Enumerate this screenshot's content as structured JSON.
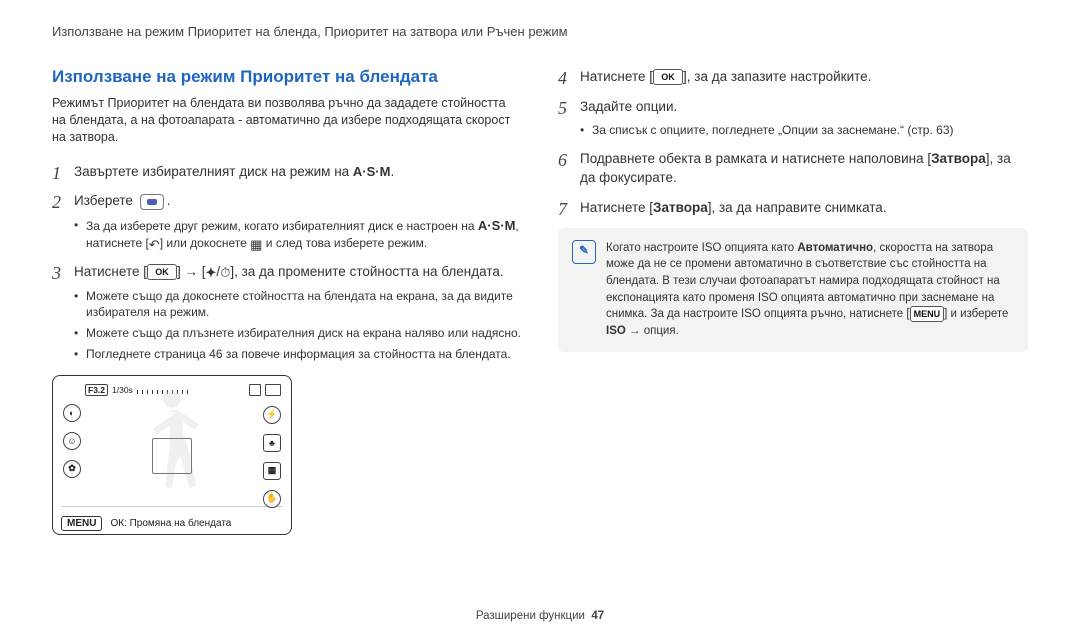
{
  "header": {
    "breadcrumb": "Използване на режим Приоритет на бленда, Приоритет на затвора или Ръчен режим"
  },
  "title": "Използване на режим Приоритет на блендата",
  "intro": "Режимът Приоритет на блендата ви позволява ръчно да зададете стойността на блендата, а на фотоапарата ‑ автоматично да избере подходящата скорост на затвора.",
  "icons": {
    "dial_mode": "A·S·M",
    "ok": "OK",
    "flash": "✦",
    "timer": "⏱",
    "return": "↶",
    "menu": "MENU",
    "arrow": "→"
  },
  "steps_left": {
    "s1": {
      "text_a": "Завъртете избирателният диск на режим на ",
      "text_b": "."
    },
    "s2": {
      "text_a": "Изберете ",
      "sub1_a": "За да изберете друг режим, когато избирателният диск е настроен на ",
      "sub1_b": ", натиснете [",
      "sub1_c": "] или докоснете ",
      "sub1_d": " и след това изберете режим."
    },
    "s3": {
      "text_a": "Натиснете [",
      "text_b": "] → [",
      "text_c": "/",
      "text_d": "], за да промените стойността на блендата.",
      "sub1": "Можете също да докоснете стойността на блендата на екрана, за да видите избирателя на режим.",
      "sub2": "Можете също да плъзнете избирателния диск на екрана наляво или надясно.",
      "sub3": "Погледнете страница 46 за повече информация за стойността на блендата."
    }
  },
  "steps_right": {
    "s4": {
      "text_a": "Натиснете [",
      "text_b": "], за да запазите настройките."
    },
    "s5": {
      "text": "Задайте опции.",
      "sub1": "За списък с опциите, погледнете „Опции за заснемане.“ (стр. 63)"
    },
    "s6": {
      "text_a": "Подравнете обекта в рамката и натиснете наполовина [",
      "bold": "Затвора",
      "text_b": "], за да фокусирате."
    },
    "s7": {
      "text_a": "Натиснете [",
      "bold": "Затвора",
      "text_b": "], за да направите снимката."
    }
  },
  "note": {
    "line1_a": "Когато настроите ISO опцията като ",
    "line1_bold": "Автоматично",
    "line1_b": ", скоростта на затвора може да не се промени автоматично в съответствие със стойността на блендата. В тези случаи фотоапаратът намира подходящата стойност на експонацията като променя ISO опцията автоматично при заснемане на снимка. За да настроите ISO опцията ръчно, натиснете [",
    "line1_menu_after": "] и изберете ",
    "line1_iso": "ISO",
    "line1_end": " → опция."
  },
  "lcd": {
    "aperture": "F3.2",
    "shutter": "1/30s",
    "bottom_label": "ОК: Промяна на блендата"
  },
  "footer": {
    "section": "Разширени функции",
    "page": "47"
  },
  "chart_data": null
}
